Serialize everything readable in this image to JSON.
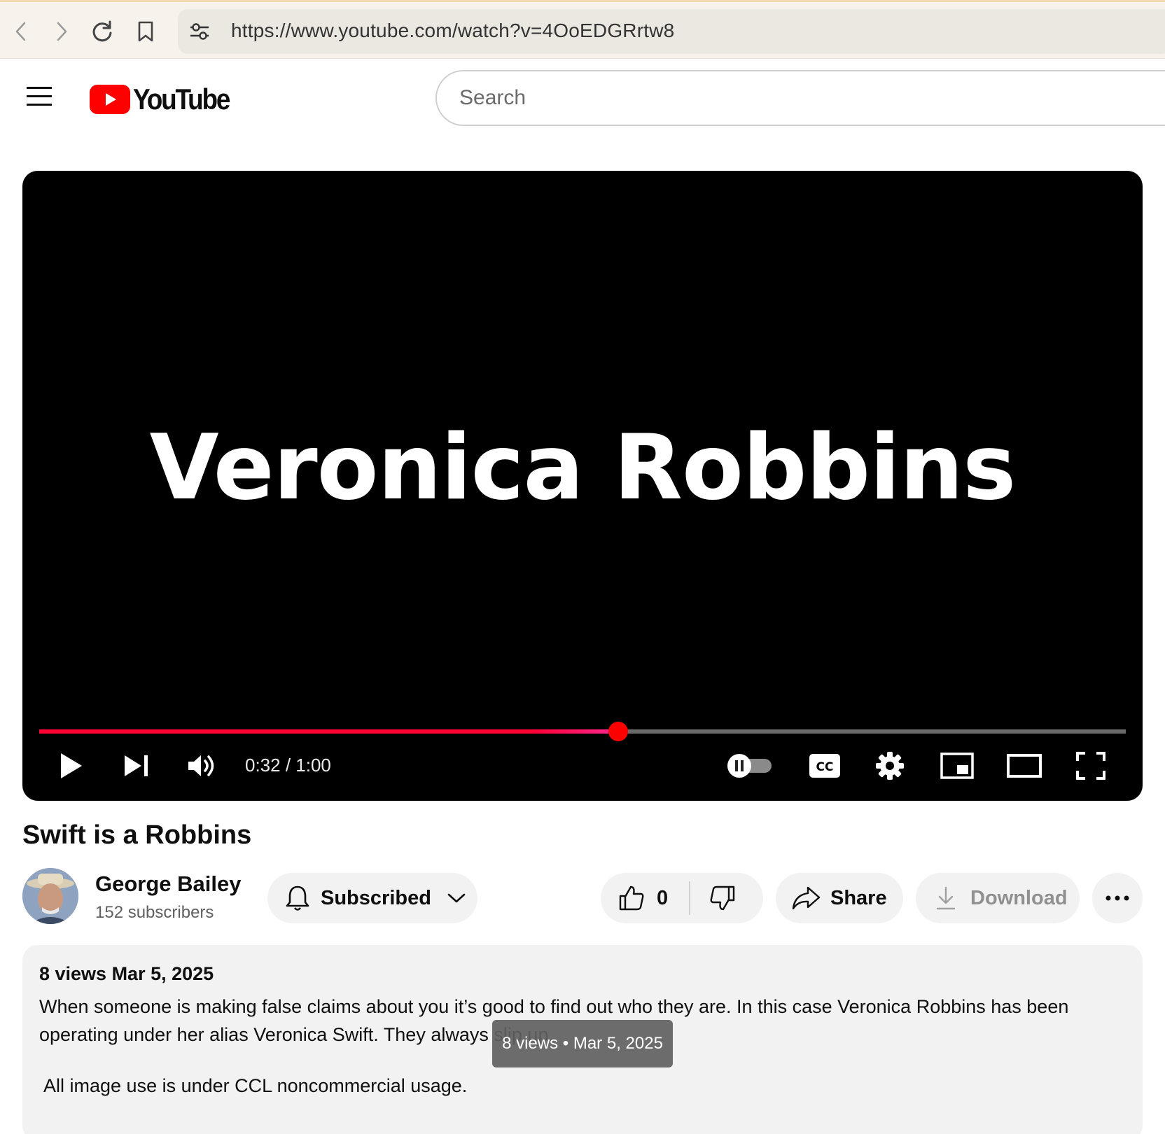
{
  "browser": {
    "url": "https://www.youtube.com/watch?v=4OoEDGRrtw8"
  },
  "header": {
    "logo_text": "YouTube",
    "search_placeholder": "Search"
  },
  "player": {
    "overlay_text": "Veronica Robbins",
    "time_display": "0:32 / 1:00",
    "progress_fraction": 0.533
  },
  "video": {
    "title": "Swift is a Robbins"
  },
  "channel": {
    "name": "George Bailey",
    "subscribers": "152 subscribers"
  },
  "actions": {
    "subscribed_label": "Subscribed",
    "like_count": "0",
    "share_label": "Share",
    "download_label": "Download"
  },
  "description": {
    "meta": "8 views  Mar 5, 2025",
    "paragraph_1": "When someone is making false claims about you it’s good to find out who they are.  In this case Veronica Robbins has been operating under her alias Veronica Swift.  They always slip up.",
    "paragraph_2": "All image use is under CCL noncommercial usage.",
    "tooltip": "8 views • Mar 5, 2025"
  },
  "colors": {
    "brand_red": "#ff0000",
    "progress_red": "#ff0033"
  }
}
